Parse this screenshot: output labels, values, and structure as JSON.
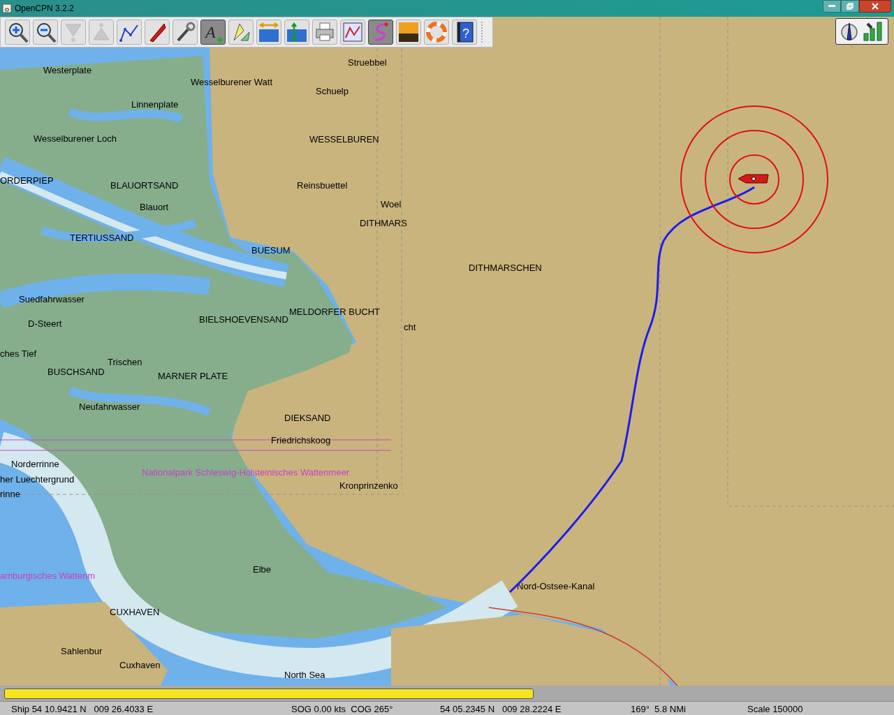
{
  "window": {
    "title": "OpenCPN 3.2.2"
  },
  "toolbar": {
    "buttons": [
      {
        "kind": "zoom-in",
        "selected": false,
        "disabled": false
      },
      {
        "kind": "zoom-out",
        "selected": false,
        "disabled": false
      },
      {
        "kind": "funnel-down",
        "selected": false,
        "disabled": true
      },
      {
        "kind": "funnel-up",
        "selected": false,
        "disabled": true
      },
      {
        "kind": "route",
        "selected": false,
        "disabled": false
      },
      {
        "kind": "ship",
        "selected": false,
        "disabled": false
      },
      {
        "kind": "wrench",
        "selected": false,
        "disabled": false
      },
      {
        "kind": "text",
        "selected": true,
        "disabled": false,
        "glyph": "A"
      },
      {
        "kind": "flags",
        "selected": false,
        "disabled": false
      },
      {
        "kind": "tide",
        "selected": false,
        "disabled": false
      },
      {
        "kind": "current",
        "selected": false,
        "disabled": false
      },
      {
        "kind": "printer",
        "selected": false,
        "disabled": false
      },
      {
        "kind": "manager",
        "selected": false,
        "disabled": false
      },
      {
        "kind": "track",
        "selected": true,
        "disabled": false
      },
      {
        "kind": "sunset",
        "selected": false,
        "disabled": false
      },
      {
        "kind": "lifebuoy",
        "selected": false,
        "disabled": false
      },
      {
        "kind": "help",
        "selected": false,
        "disabled": false,
        "glyph": "?"
      }
    ]
  },
  "chart": {
    "labels": [
      {
        "text": "Struebbel",
        "kind": "place"
      },
      {
        "text": "Westerplate",
        "kind": "place"
      },
      {
        "text": "Wesselburener Watt",
        "kind": "place"
      },
      {
        "text": "Schuelp",
        "kind": "place"
      },
      {
        "text": "Linnenplate",
        "kind": "place"
      },
      {
        "text": "Wesselburener Loch",
        "kind": "place"
      },
      {
        "text": "WESSELBUREN",
        "kind": "place"
      },
      {
        "text": "ORDERPIEP",
        "kind": "place"
      },
      {
        "text": "BLAUORTSAND",
        "kind": "place"
      },
      {
        "text": "Reinsbuettel",
        "kind": "place"
      },
      {
        "text": "Woel",
        "kind": "place"
      },
      {
        "text": "Blauort",
        "kind": "place"
      },
      {
        "text": "DITHMARS",
        "kind": "place"
      },
      {
        "text": "TERTIUSSAND",
        "kind": "place"
      },
      {
        "text": "BUESUM",
        "kind": "place"
      },
      {
        "text": "DITHMARSCHEN",
        "kind": "place"
      },
      {
        "text": "Suedfahrwasser",
        "kind": "place"
      },
      {
        "text": "MELDORFER BUCHT",
        "kind": "place"
      },
      {
        "text": "BIELSHOEVENSAND",
        "kind": "place"
      },
      {
        "text": "D-Steert",
        "kind": "place"
      },
      {
        "text": "cht",
        "kind": "place"
      },
      {
        "text": "ches Tief",
        "kind": "place"
      },
      {
        "text": "Trischen",
        "kind": "place"
      },
      {
        "text": "BUSCHSAND",
        "kind": "place"
      },
      {
        "text": "MARNER PLATE",
        "kind": "place"
      },
      {
        "text": "Neufahrwasser",
        "kind": "place"
      },
      {
        "text": "DIEKSAND",
        "kind": "place"
      },
      {
        "text": "Friedrichskoog",
        "kind": "place"
      },
      {
        "text": "Norderrinne",
        "kind": "place"
      },
      {
        "text": "Nationalpark Schleswig-Holsteinisches Wattenmeer",
        "kind": "area"
      },
      {
        "text": "her Luechtergrund",
        "kind": "place"
      },
      {
        "text": "Kronprinzenko",
        "kind": "place"
      },
      {
        "text": "rinne",
        "kind": "place"
      },
      {
        "text": "Elbe",
        "kind": "place"
      },
      {
        "text": "amburgisches Wattenm",
        "kind": "area"
      },
      {
        "text": "Nord-Ostsee-Kanal",
        "kind": "place"
      },
      {
        "text": "CUXHAVEN",
        "kind": "place"
      },
      {
        "text": "Sahlenbur",
        "kind": "place"
      },
      {
        "text": "Cuxhaven",
        "kind": "place"
      },
      {
        "text": "North Sea",
        "kind": "place"
      }
    ]
  },
  "status_bar": {
    "fields": [
      "Ship 54 10.9421 N   009 26.4033 E",
      "SOG 0.00 kts  COG 265°",
      "54 05.2345 N   009 28.2224 E",
      "169°  5.8 NMi",
      "Scale 150000"
    ]
  }
}
